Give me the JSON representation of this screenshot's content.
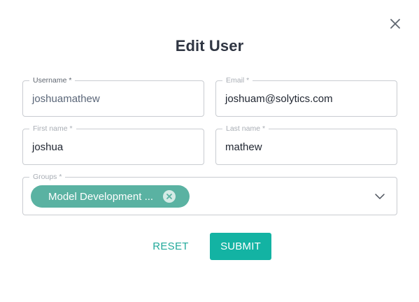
{
  "dialog": {
    "title": "Edit User",
    "close_icon": "close-icon"
  },
  "form": {
    "username": {
      "label": "Username *",
      "value": "joshuamathew"
    },
    "email": {
      "label": "Email *",
      "value": "joshuam@solytics.com"
    },
    "first_name": {
      "label": "First name *",
      "value": "joshua"
    },
    "last_name": {
      "label": "Last name *",
      "value": "mathew"
    },
    "groups": {
      "label": "Groups *",
      "chips": [
        {
          "label": "Model Development ...",
          "remove_icon": "remove-chip-icon"
        }
      ],
      "dropdown_icon": "chevron-down-icon"
    }
  },
  "actions": {
    "reset_label": "RESET",
    "submit_label": "SUBMIT"
  },
  "colors": {
    "accent": "#13b3a3",
    "chip": "#5ab2a2",
    "title": "#2f3542",
    "border": "#c9ccd1"
  }
}
